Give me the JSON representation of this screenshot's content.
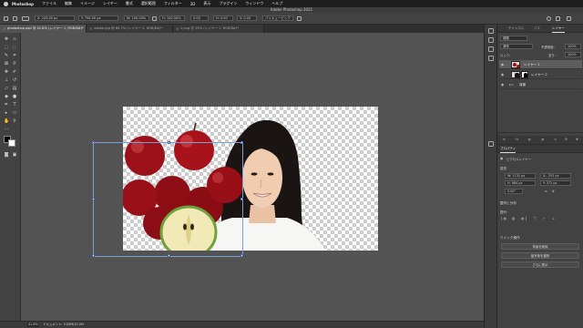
{
  "menubar": {
    "app_name": "Photoshop",
    "items": [
      "ファイル",
      "編集",
      "イメージ",
      "レイヤー",
      "書式",
      "選択範囲",
      "フィルター",
      "3D",
      "表示",
      "プラグイン",
      "ウィンドウ",
      "ヘルプ"
    ],
    "window_title": "Adobe Photoshop 2021"
  },
  "options_bar": {
    "x_value": "X: 243.00 px",
    "y_value": "Y: 794.50 px",
    "w_value": "W: 100.00%",
    "h_value": "H: 100.00%",
    "angle_value": "0.00",
    "h_skew_value": "H: 0.00",
    "v_skew_value": "V: 0.00",
    "interpolation": "バイキュービック"
  },
  "tabs": [
    {
      "label": "photoshop.psd @ 41.8% (レイヤー 1, RGB/8#)*",
      "active": true
    },
    {
      "label": "adobe.jpg @ 66.7% (レイヤー 2, RGB/8#)*",
      "active": false
    },
    {
      "label": "1.png @ 25% (レイヤー 1, RGB/8#)*",
      "active": false
    }
  ],
  "status_bar": {
    "zoom": "41.8%",
    "info": "ドキュメント: 3.00M/15.0M"
  },
  "layers_panel": {
    "tabs": [
      "チャンネル",
      "パス",
      "レイヤー"
    ],
    "active_tab": "レイヤー",
    "filter_label": "種類",
    "blend_mode": "通常",
    "opacity_label": "不透明度:",
    "opacity_value": "100%",
    "lock_label": "ロック:",
    "fill_label": "塗り:",
    "fill_value": "100%",
    "layers": [
      {
        "name": "レイヤー 1",
        "selected": true
      },
      {
        "name": "レイヤー 2",
        "selected": false
      },
      {
        "name": "背景",
        "selected": false
      }
    ]
  },
  "properties_panel": {
    "tab": "プロパティ",
    "layer_type": "ピクセルレイヤー",
    "transform_header": "変形",
    "w_value": "W: 1132 px",
    "x_value": "X: -253 px",
    "h_value": "H: 984 px",
    "y_value": "Y: 372 px",
    "angle_value": "0.00°",
    "align_header": "整列と分布",
    "align_label": "整列:",
    "quick_actions_header": "クイック操作",
    "buttons": [
      "背景を削除",
      "被写体を選択",
      "さらに表示"
    ]
  },
  "colors": {
    "accent_selection": "#7a9ed6",
    "panel_bg": "#424242",
    "canvas_bg": "#535353"
  }
}
